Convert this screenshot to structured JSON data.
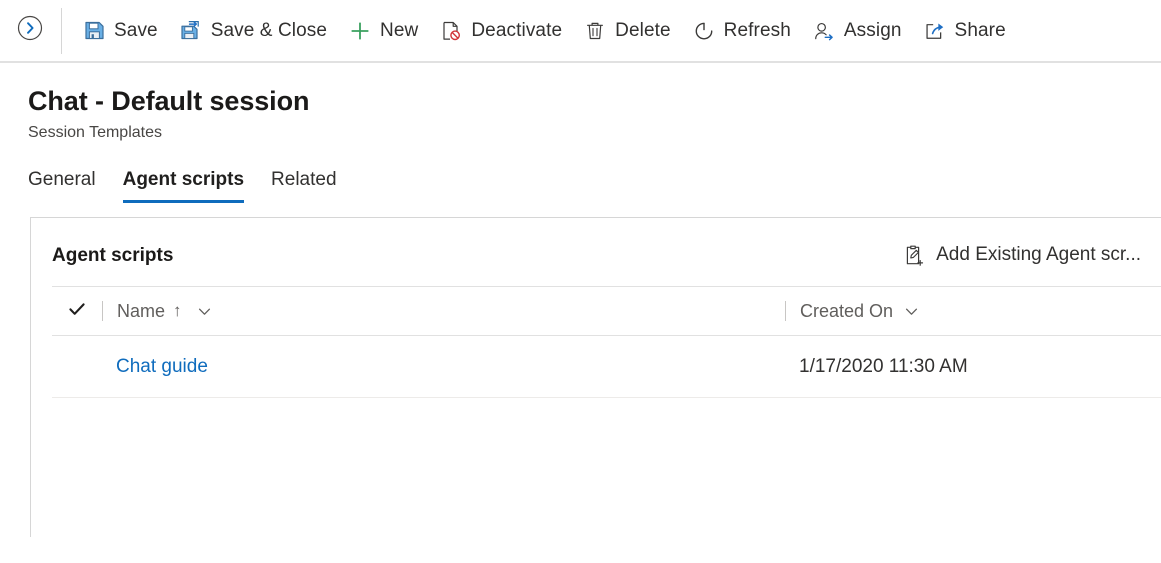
{
  "commandbar": {
    "back_icon": "chevron-right-circle-icon",
    "buttons": [
      {
        "label": "Save",
        "icon": "save-floppy-icon"
      },
      {
        "label": "Save & Close",
        "icon": "save-and-close-icon"
      },
      {
        "label": "New",
        "icon": "plus-icon"
      },
      {
        "label": "Deactivate",
        "icon": "deactivate-page-icon"
      },
      {
        "label": "Delete",
        "icon": "trash-icon"
      },
      {
        "label": "Refresh",
        "icon": "refresh-icon"
      },
      {
        "label": "Assign",
        "icon": "assign-person-icon"
      },
      {
        "label": "Share",
        "icon": "share-icon"
      }
    ]
  },
  "header": {
    "title": "Chat - Default session",
    "subtitle": "Session Templates"
  },
  "tabs": [
    {
      "label": "General",
      "active": false
    },
    {
      "label": "Agent scripts",
      "active": true
    },
    {
      "label": "Related",
      "active": false
    }
  ],
  "section": {
    "title": "Agent scripts",
    "action": {
      "label": "Add Existing Agent scr...",
      "icon": "add-existing-clipboard-icon"
    }
  },
  "grid": {
    "select_all_icon": "checkmark-icon",
    "columns": [
      {
        "label": "Name",
        "sort": "ascending",
        "sort_arrow": "↑",
        "chevron": "chevron-down-icon"
      },
      {
        "label": "Created On",
        "sort": "none",
        "sort_arrow": "",
        "chevron": "chevron-down-icon"
      }
    ],
    "rows": [
      {
        "name": "Chat guide",
        "created_on": "1/17/2020 11:30 AM"
      }
    ]
  },
  "colors": {
    "accent": "#0f6cbd",
    "link": "#0f6cbd",
    "new_green": "#3aa05f",
    "danger_red": "#d13438",
    "text": "#323130",
    "muted_text": "#605e5c",
    "border": "#d6d6d6",
    "row_border": "#edebe9"
  }
}
